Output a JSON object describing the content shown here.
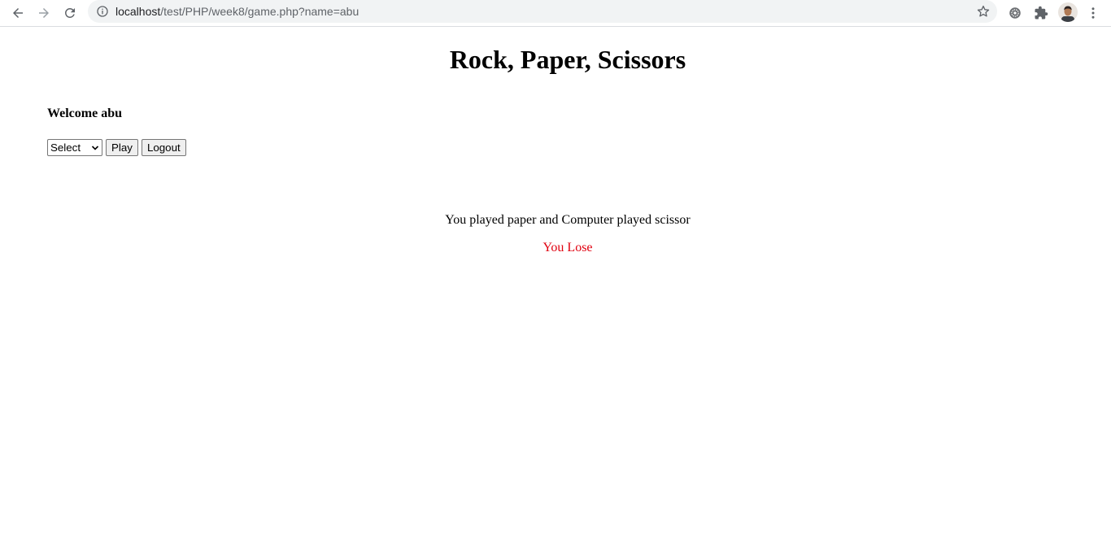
{
  "browser": {
    "url_host": "localhost",
    "url_path": "/test/PHP/week8/game.php?name=abu",
    "back_icon": "arrow-left-icon",
    "forward_icon": "arrow-right-icon",
    "reload_icon": "reload-icon",
    "info_icon": "info-icon",
    "bookmark_icon": "star-icon",
    "extension_icons": [
      "settings-extension-icon",
      "puzzle-icon"
    ],
    "menu_icon": "kebab-menu-icon"
  },
  "page": {
    "title": "Rock, Paper, Scissors",
    "welcome": "Welcome abu",
    "select": {
      "selected": "Select"
    },
    "play_label": "Play",
    "logout_label": "Logout",
    "result_text": "You played paper and Computer played scissor",
    "outcome_text": "You Lose",
    "outcome_color": "#e0000f"
  }
}
